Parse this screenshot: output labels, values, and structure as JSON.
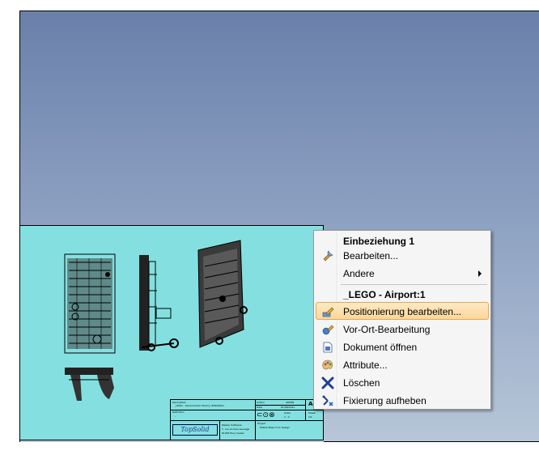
{
  "context_menu": {
    "items": [
      {
        "label": "Einbeziehung 1",
        "kind": "header",
        "icon": ""
      },
      {
        "label": "Bearbeiten...",
        "kind": "item",
        "icon": "wrench-pencil-icon"
      },
      {
        "label": "Andere",
        "kind": "submenu",
        "icon": ""
      },
      {
        "label": "_LEGO - Airport:1",
        "kind": "header",
        "icon": ""
      },
      {
        "label": "Positionierung bearbeiten...",
        "kind": "item",
        "icon": "position-edit-icon",
        "highlighted": true
      },
      {
        "label": "Vor-Ort-Bearbeitung",
        "kind": "item",
        "icon": "in-place-edit-icon"
      },
      {
        "label": "Dokument öffnen",
        "kind": "item",
        "icon": "open-document-icon"
      },
      {
        "label": "Attribute...",
        "kind": "item",
        "icon": "palette-icon"
      },
      {
        "label": "Löschen",
        "kind": "item",
        "icon": "delete-x-icon"
      },
      {
        "label": "Fixierung aufheben",
        "kind": "item",
        "icon": "unfix-icon"
      }
    ]
  },
  "title_block": {
    "description_label": "Description",
    "description_value": "_LEGO - Sensoraction Factory #SSSSSS1",
    "definition_label": "Definition",
    "definition_value": "-",
    "author_label": "Author",
    "author_value": "ADMIN",
    "date_label": "Date",
    "date_value": "01/06/2011",
    "format_value": "A4",
    "scale_label": "Scale",
    "scale_value": "1 : 2",
    "sheet_label": "Sheet",
    "sheet_value": "1/1",
    "logo_text": "TopSolid",
    "company_line1": "Missler Software",
    "company_line2": "7, rue du bois sauvage",
    "company_line3": "91055 Evry Cedex",
    "project_label": "Project",
    "project_value": "Mobile Base 9.11 Design"
  },
  "colors": {
    "sheet": "#84e0e0",
    "highlight": "#fbd79a",
    "menu_bg": "#f5f5f5"
  }
}
